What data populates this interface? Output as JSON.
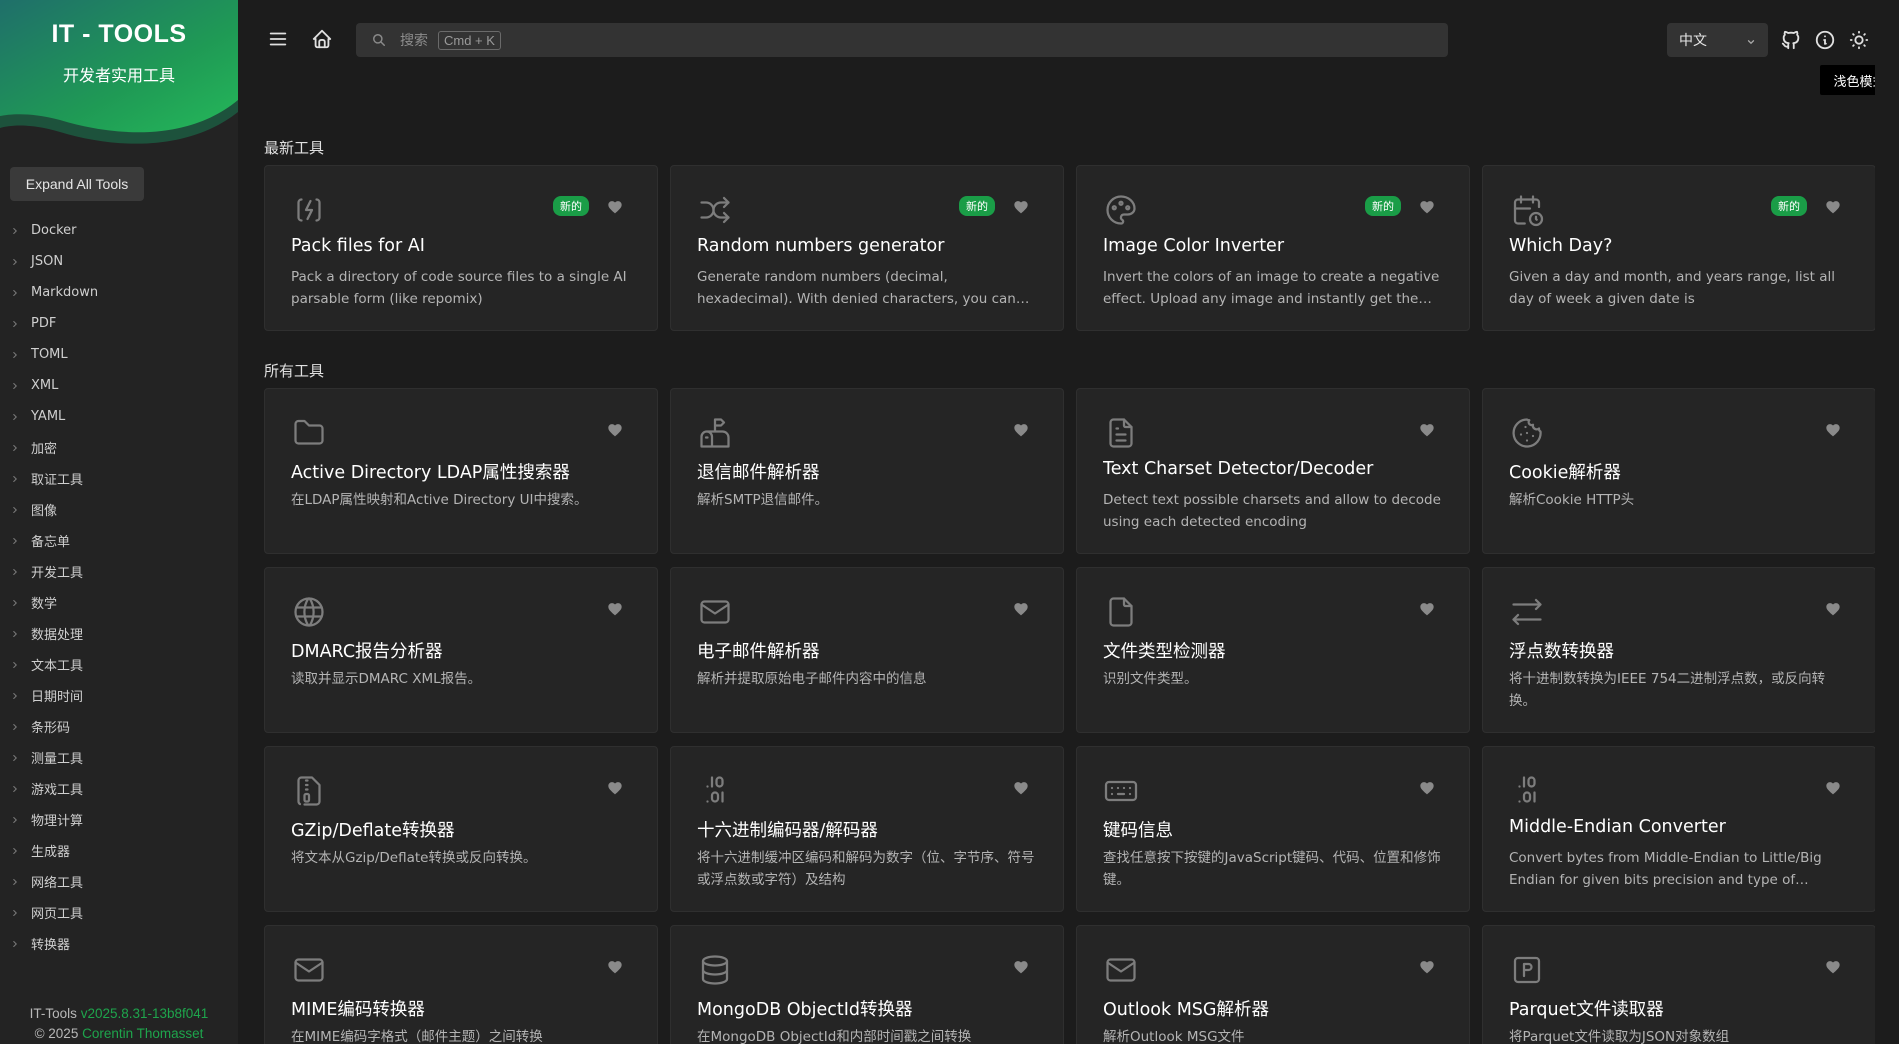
{
  "sidebar": {
    "app_title": "IT - TOOLS",
    "app_subtitle": "开发者实用工具",
    "expand_label": "Expand All Tools",
    "categories": [
      "Docker",
      "JSON",
      "Markdown",
      "PDF",
      "TOML",
      "XML",
      "YAML",
      "加密",
      "取证工具",
      "图像",
      "备忘单",
      "开发工具",
      "数学",
      "数据处理",
      "文本工具",
      "日期时间",
      "条形码",
      "测量工具",
      "游戏工具",
      "物理计算",
      "生成器",
      "网络工具",
      "网页工具",
      "转换器"
    ],
    "footer": {
      "brand": "IT-Tools",
      "version": "v2025.8.31-13b8f041",
      "copyright": "© 2025",
      "author": "Corentin Thomasset"
    }
  },
  "header": {
    "search_placeholder": "搜索",
    "search_shortcut": "Cmd + K",
    "language": "中文",
    "tooltip": "浅色模式"
  },
  "sections": {
    "newest": "最新工具",
    "all": "所有工具"
  },
  "new_badge": "新的",
  "newest_tools": [
    {
      "icon": "file-bolt-icon",
      "title": "Pack files for AI",
      "desc": "Pack a directory of code source files to a single AI parsable form (like repomix)"
    },
    {
      "icon": "shuffle-icon",
      "title": "Random numbers generator",
      "desc": "Generate random numbers (decimal, hexadecimal). With denied characters, you can generate other..."
    },
    {
      "icon": "palette-icon",
      "title": "Image Color Inverter",
      "desc": "Invert the colors of an image to create a negative effect. Upload any image and instantly get the colo..."
    },
    {
      "icon": "calendar-clock-icon",
      "title": "Which Day?",
      "desc": "Given a day and month, and years range, list all day of week a given date is"
    }
  ],
  "all_tools": [
    {
      "icon": "folder-icon",
      "title": "Active Directory LDAP属性搜索器",
      "desc": "在LDAP属性映射和Active Directory UI中搜索。"
    },
    {
      "icon": "mailbox-icon",
      "title": "退信邮件解析器",
      "desc": "解析SMTP退信邮件。"
    },
    {
      "icon": "file-text-icon",
      "title": "Text Charset Detector/Decoder",
      "desc": "Detect text possible charsets and allow to decode using each detected encoding"
    },
    {
      "icon": "cookie-icon",
      "title": "Cookie解析器",
      "desc": "解析Cookie HTTP头"
    },
    {
      "icon": "world-icon",
      "title": "DMARC报告分析器",
      "desc": "读取并显示DMARC XML报告。"
    },
    {
      "icon": "mail-icon",
      "title": "电子邮件解析器",
      "desc": "解析并提取原始电子邮件内容中的信息"
    },
    {
      "icon": "file-icon",
      "title": "文件类型检测器",
      "desc": "识别文件类型。"
    },
    {
      "icon": "arrows-left-right-icon",
      "title": "浮点数转换器",
      "desc": "将十进制数转换为IEEE 754二进制浮点数，或反向转换。"
    },
    {
      "icon": "file-zip-icon",
      "title": "GZip/Deflate转换器",
      "desc": "将文本从Gzip/Deflate转换或反向转换。"
    },
    {
      "icon": "decimal-icon",
      "title": "十六进制编码器/解码器",
      "desc": "将十六进制缓冲区编码和解码为数字（位、字节序、符号或浮点数或字符）及结构"
    },
    {
      "icon": "keyboard-icon",
      "title": "键码信息",
      "desc": "查找任意按下按键的JavaScript键码、代码、位置和修饰键。"
    },
    {
      "icon": "decimal-icon",
      "title": "Middle-Endian Converter",
      "desc": "Convert bytes from Middle-Endian to Little/Big Endian for given bits precision and type of Middle..."
    },
    {
      "icon": "mail-icon",
      "title": "MIME编码转换器",
      "desc": "在MIME编码字格式（邮件主题）之间转换"
    },
    {
      "icon": "database-icon",
      "title": "MongoDB ObjectId转换器",
      "desc": "在MongoDB ObjectId和内部时间戳之间转换"
    },
    {
      "icon": "mail-icon",
      "title": "Outlook MSG解析器",
      "desc": "解析Outlook MSG文件"
    },
    {
      "icon": "parquet-icon",
      "title": "Parquet文件读取器",
      "desc": "将Parquet文件读取为JSON对象数组"
    }
  ]
}
